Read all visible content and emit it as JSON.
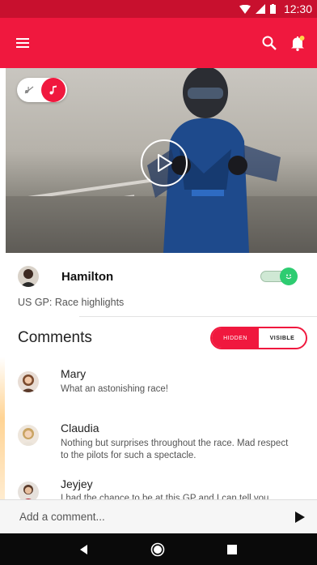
{
  "status_bar": {
    "time": "12:30"
  },
  "video": {
    "music_on": true
  },
  "post": {
    "author": "Hamilton",
    "subtitle": "US GP: Race highlights",
    "visible_toggle": true
  },
  "comments": {
    "title": "Comments",
    "filter": {
      "hidden_label": "HIDDEN",
      "visible_label": "VISIBLE",
      "selected": "VISIBLE"
    },
    "items": [
      {
        "name": "Mary",
        "text": "What an astonishing race!"
      },
      {
        "name": "Claudia",
        "text": "Nothing but surprises throughout the race. Mad respect to the pilots for such a spectacle."
      },
      {
        "name": "Jeyjey",
        "text": "I had the chance to be at this GP and I can tell you"
      }
    ]
  },
  "composer": {
    "placeholder": "Add a comment..."
  },
  "colors": {
    "brand": "#f0183e",
    "status_bar": "#c8102e",
    "toggle_on": "#2ecc71"
  },
  "icons": [
    "menu-icon",
    "search-icon",
    "notification-bell-icon",
    "play-icon",
    "music-note-icon",
    "send-icon",
    "back-icon",
    "home-icon",
    "recents-icon"
  ]
}
